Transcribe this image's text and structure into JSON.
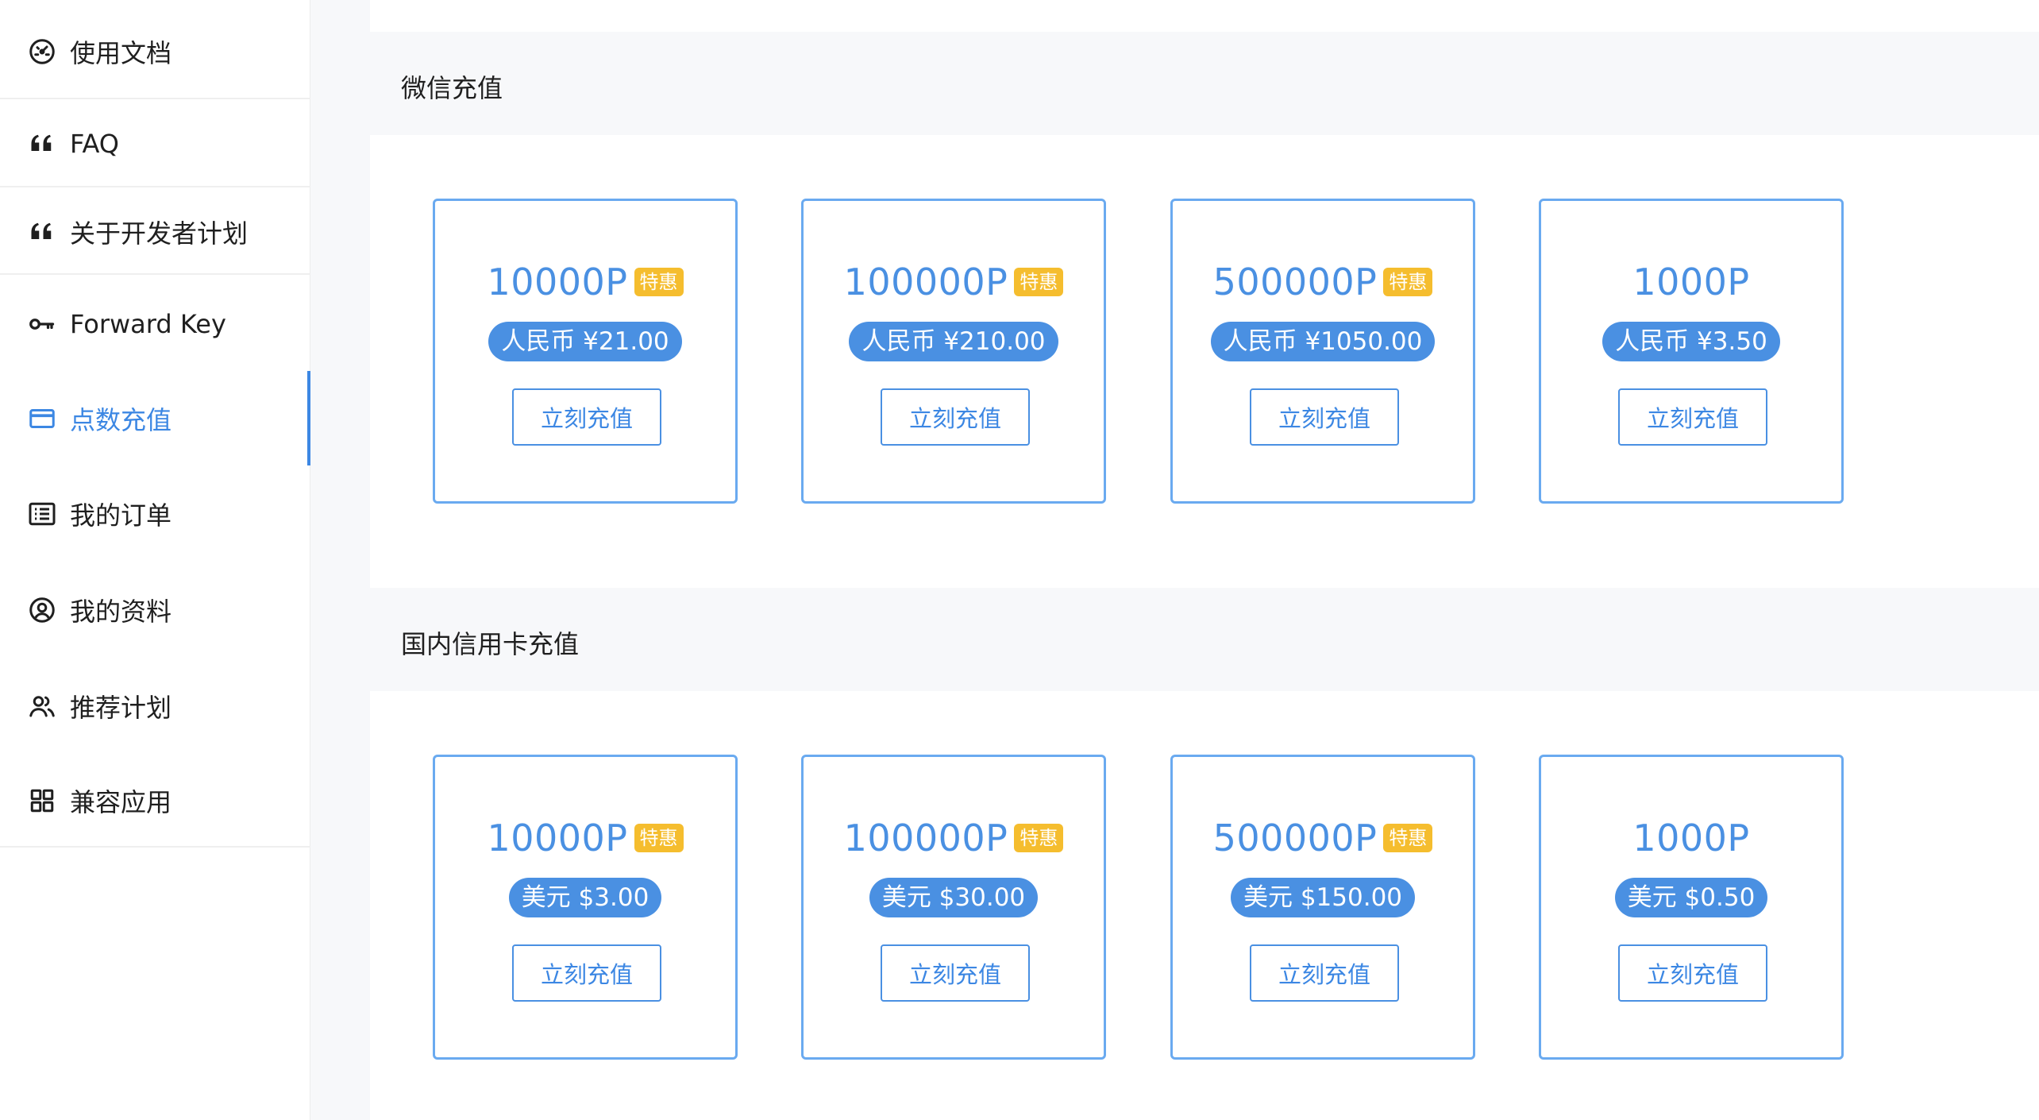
{
  "sidebar": {
    "items": [
      {
        "label": "使用文档",
        "icon": "speedometer-icon"
      },
      {
        "label": "FAQ",
        "icon": "quote-icon"
      },
      {
        "label": "关于开发者计划",
        "icon": "quote-icon"
      },
      {
        "label": "Forward Key",
        "icon": "key-icon"
      },
      {
        "label": "点数充值",
        "icon": "credit-card-icon",
        "active": true
      },
      {
        "label": "我的订单",
        "icon": "list-icon"
      },
      {
        "label": "我的资料",
        "icon": "user-circle-icon"
      },
      {
        "label": "推荐计划",
        "icon": "users-icon"
      },
      {
        "label": "兼容应用",
        "icon": "grid-icon"
      }
    ]
  },
  "sections": [
    {
      "title": "微信充值",
      "cards": [
        {
          "points": "10000P",
          "badge": "特惠",
          "price": "人民币 ¥21.00",
          "button": "立刻充值"
        },
        {
          "points": "100000P",
          "badge": "特惠",
          "price": "人民币 ¥210.00",
          "button": "立刻充值"
        },
        {
          "points": "500000P",
          "badge": "特惠",
          "price": "人民币 ¥1050.00",
          "button": "立刻充值"
        },
        {
          "points": "1000P",
          "badge": "",
          "price": "人民币 ¥3.50",
          "button": "立刻充值"
        }
      ]
    },
    {
      "title": "国内信用卡充值",
      "cards": [
        {
          "points": "10000P",
          "badge": "特惠",
          "price": "美元 $3.00",
          "button": "立刻充值"
        },
        {
          "points": "100000P",
          "badge": "特惠",
          "price": "美元 $30.00",
          "button": "立刻充值"
        },
        {
          "points": "500000P",
          "badge": "特惠",
          "price": "美元 $150.00",
          "button": "立刻充值"
        },
        {
          "points": "1000P",
          "badge": "",
          "price": "美元 $0.50",
          "button": "立刻充值"
        }
      ]
    }
  ],
  "colors": {
    "accent": "#4a90e2",
    "badge": "#f5bd2e",
    "page_bg": "#f7f8fa"
  }
}
